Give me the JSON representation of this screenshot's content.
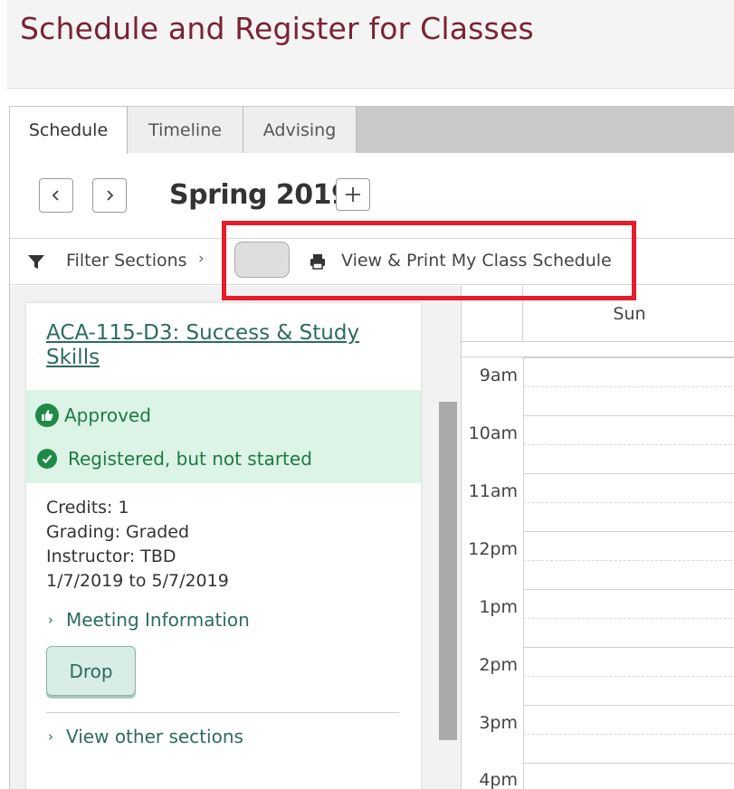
{
  "page": {
    "title": "Schedule and Register for Classes"
  },
  "tabs": [
    {
      "label": "Schedule",
      "active": true
    },
    {
      "label": "Timeline",
      "active": false
    },
    {
      "label": "Advising",
      "active": false
    }
  ],
  "term": {
    "title": "Spring 2019",
    "prev_icon": "chevron-left-icon",
    "next_icon": "chevron-right-icon",
    "add_icon": "plus-icon"
  },
  "toolbar": {
    "filter_label": "Filter Sections",
    "filter_icon": "funnel-icon",
    "print_label": "View & Print My Class Schedule",
    "print_icon": "printer-icon"
  },
  "course": {
    "link": "ACA-115-D3: Success & Study Skills",
    "status_approved": "Approved",
    "status_registered": "Registered, but not started",
    "credits": "Credits: 1",
    "grading": "Grading: Graded",
    "instructor": "Instructor: TBD",
    "dates": "1/7/2019 to 5/7/2019",
    "meeting_info": "Meeting Information",
    "drop_label": "Drop",
    "other_sections": "View other sections"
  },
  "calendar": {
    "day": "Sun",
    "times": [
      "9am",
      "10am",
      "11am",
      "12pm",
      "1pm",
      "2pm",
      "3pm",
      "4pm"
    ]
  },
  "colors": {
    "title": "#7a2233",
    "accent": "#2c6b5f",
    "status_bg": "#dcf4e6",
    "status_text": "#1e7a42",
    "highlight": "#e41e2a"
  }
}
